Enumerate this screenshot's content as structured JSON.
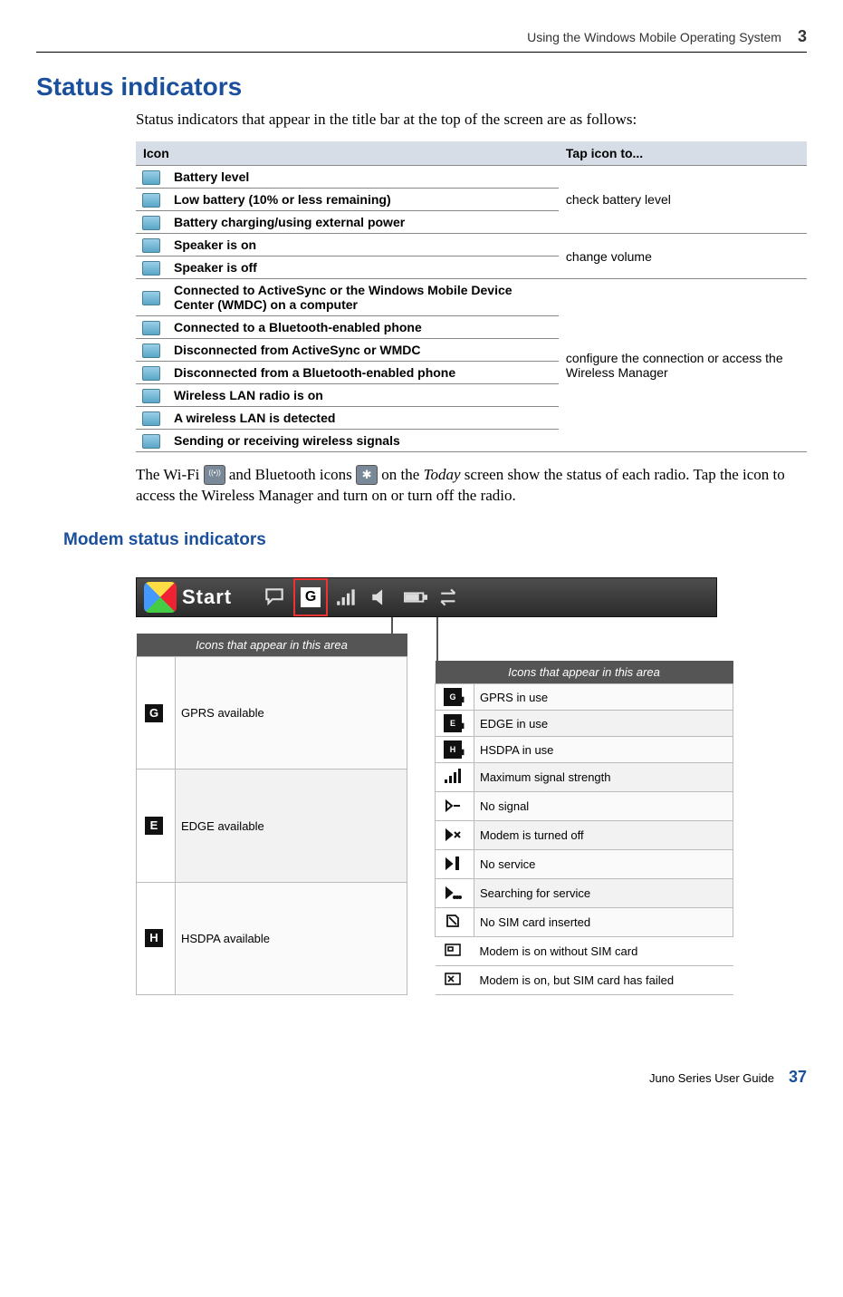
{
  "header": {
    "chapter_title": "Using the Windows Mobile Operating System",
    "chapter_number": "3"
  },
  "section": {
    "title": "Status indicators",
    "lead": "Status indicators that appear in the title bar at the top of the screen are as follows:"
  },
  "status_table": {
    "col_icon": "Icon",
    "col_action": "Tap icon to...",
    "groups": [
      {
        "action": "check battery level",
        "rows": [
          {
            "label": "Battery level"
          },
          {
            "label": "Low battery (10% or less remaining)"
          },
          {
            "label": "Battery charging/using external power"
          }
        ]
      },
      {
        "action": "change volume",
        "rows": [
          {
            "label": "Speaker is on"
          },
          {
            "label": "Speaker is off"
          }
        ]
      },
      {
        "action": "configure the connection or access the Wireless Manager",
        "rows": [
          {
            "label": "Connected to ActiveSync or the Windows Mobile Device Center (WMDC) on a computer"
          },
          {
            "label": "Connected to a Bluetooth-enabled phone"
          },
          {
            "label": "Disconnected from ActiveSync or WMDC"
          },
          {
            "label": "Disconnected from a Bluetooth-enabled phone"
          },
          {
            "label": "Wireless LAN radio is on"
          },
          {
            "label": "A wireless LAN is detected"
          },
          {
            "label": "Sending or receiving wireless signals"
          }
        ]
      }
    ]
  },
  "after_table": {
    "part1": "The Wi-Fi ",
    "part2": " and Bluetooth icons ",
    "part3": " on the ",
    "today": "Today",
    "part4": " screen show the status of each radio. Tap the icon to access the Wireless Manager and turn on or turn off the radio."
  },
  "subsection": {
    "title": "Modem status indicators"
  },
  "modem": {
    "start_label": "Start",
    "g_letter": "G",
    "left_header": "Icons that appear in this area",
    "right_header": "Icons that appear in this area",
    "left_rows": [
      {
        "glyph": "G",
        "label": "GPRS available"
      },
      {
        "glyph": "E",
        "label": "EDGE available"
      },
      {
        "glyph": "H",
        "label": "HSDPA available"
      }
    ],
    "right_rows": [
      {
        "glyph": "G",
        "label": "GPRS in use",
        "bars": true
      },
      {
        "glyph": "E",
        "label": "EDGE in use",
        "bars": true
      },
      {
        "glyph": "H",
        "label": "HSDPA in use",
        "bars": true
      },
      {
        "icon": "signal-max",
        "label": "Maximum signal strength"
      },
      {
        "icon": "signal-none",
        "label": "No signal"
      },
      {
        "icon": "signal-off",
        "label": "Modem is turned off"
      },
      {
        "icon": "signal-noservice",
        "label": "No service"
      },
      {
        "icon": "signal-search",
        "label": "Searching for service"
      },
      {
        "icon": "sim-none",
        "label": "No SIM card inserted"
      },
      {
        "icon": "sim-no-card",
        "label": "Modem is on without SIM card",
        "white": true
      },
      {
        "icon": "sim-fail",
        "label": "Modem is on, but SIM card has failed",
        "white": true
      }
    ]
  },
  "footer": {
    "guide": "Juno Series User Guide",
    "page": "37"
  }
}
